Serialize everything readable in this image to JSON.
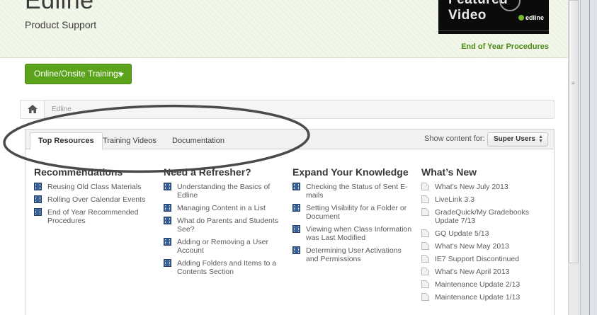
{
  "header": {
    "logo": "Edline",
    "subtitle": "Product Support",
    "featured_video": {
      "title": "Featured Video",
      "brand": "edline"
    },
    "featured_link": "End of Year Procedures"
  },
  "trainings_button": {
    "label": "Online/Onsite Trainings"
  },
  "breadcrumb": {
    "text": "Edline"
  },
  "tabs": {
    "items": [
      {
        "label": "Top Resources"
      },
      {
        "label": "Training Videos"
      },
      {
        "label": "Documentation"
      }
    ],
    "show_content_label": "Show content for:",
    "show_content_value": "Super Users"
  },
  "columns": [
    {
      "title": "Recommendations",
      "icon": "film-icon",
      "items": [
        "Reusing Old Class Materials",
        "Rolling Over Calendar Events",
        "End of Year Recommended Procedures"
      ]
    },
    {
      "title": "Need a Refresher?",
      "icon": "film-icon",
      "items": [
        "Understanding the Basics of Edline",
        "Managing Content in a List",
        "What do Parents and Students See?",
        "Adding or Removing a User Account",
        "Adding Folders and Items to a Contents Section"
      ]
    },
    {
      "title": "Expand Your Knowledge",
      "icon": "film-icon",
      "items": [
        "Checking the Status of Sent E-mails",
        "Setting Visibility for a Folder or Document",
        "Viewing when Class Information was Last Modified",
        "Determining User Activations and Permissions"
      ]
    },
    {
      "title": "What’s New",
      "icon": "document-icon",
      "items": [
        "What’s New July 2013",
        "LiveLink 3.3",
        "GradeQuick/My Gradebooks Update 7/13",
        "GQ Update 5/13",
        "What’s New May 2013",
        "IE7 Support Discontinued",
        "What’s New April 2013",
        "Maintenance Update 2/13",
        "Maintenance Update 1/13"
      ]
    }
  ],
  "colors": {
    "brand_green": "#5aa31b",
    "link_green": "#4e8a15",
    "header_bg": "#eef4e4",
    "video_icon_blue": "#38619a"
  }
}
